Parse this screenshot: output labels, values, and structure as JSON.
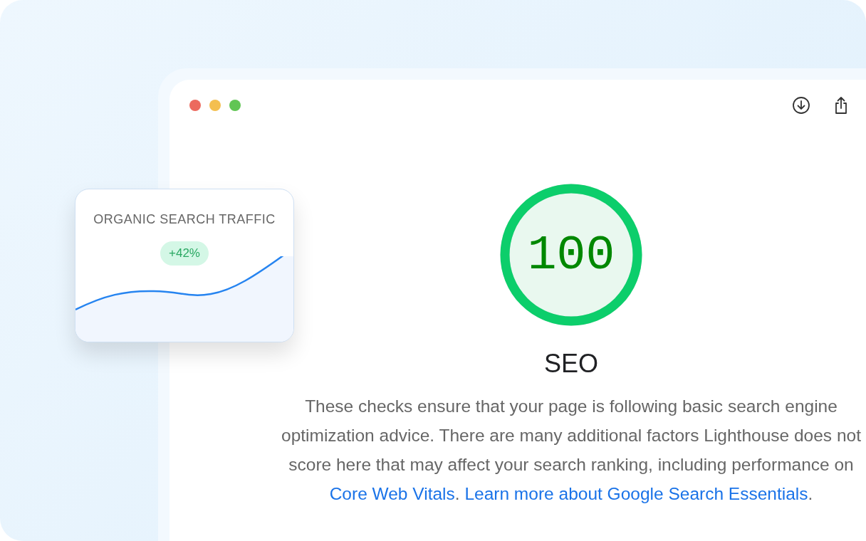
{
  "traffic_card": {
    "title": "ORGANIC SEARCH TRAFFIC",
    "badge": "+42%"
  },
  "score": {
    "value": "100",
    "level": 1,
    "category": "SEO"
  },
  "description": [
    {
      "kind": "text",
      "text": "These checks ensure that your page is following basic search engine optimization advice. There are many additional factors Lighthouse does not score here that may affect your search ranking, including performance on "
    },
    {
      "kind": "link",
      "text": "Core Web Vitals"
    },
    {
      "kind": "text",
      "text": ". "
    },
    {
      "kind": "link",
      "text": "Learn more about Google Search Essentials"
    },
    {
      "kind": "text",
      "text": "."
    }
  ]
}
